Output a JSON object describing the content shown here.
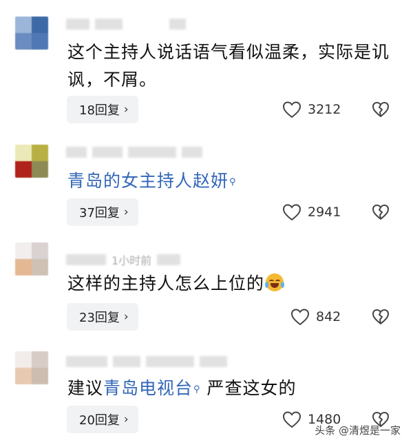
{
  "comments": [
    {
      "text_plain": "这个主持人说话语气看似温柔，实际是讥讽，不屑。",
      "replies_label": "18回复",
      "likes": "3212"
    },
    {
      "text_link": "青岛的女主持人赵妍",
      "replies_label": "37回复",
      "likes": "2941"
    },
    {
      "meta_text": "1小时前",
      "text_plain": "这样的主持人怎么上位的",
      "emoji": "laughing-crying-emoji",
      "replies_label": "23回复",
      "likes": "842"
    },
    {
      "text_prefix": "建议",
      "text_link": "青岛电视台",
      "text_suffix": " 严查这女的",
      "replies_label": "20回复",
      "likes": "1480"
    }
  ],
  "watermark": "头条 @清煜是一家",
  "icons": {
    "like": "heart-outline-icon",
    "dislike": "broken-heart-icon",
    "search": "search-icon",
    "chevron": "chevron-right-icon"
  },
  "colors": {
    "link": "#3266b8",
    "reply_bg": "#f1f2f4",
    "text": "#111111"
  }
}
